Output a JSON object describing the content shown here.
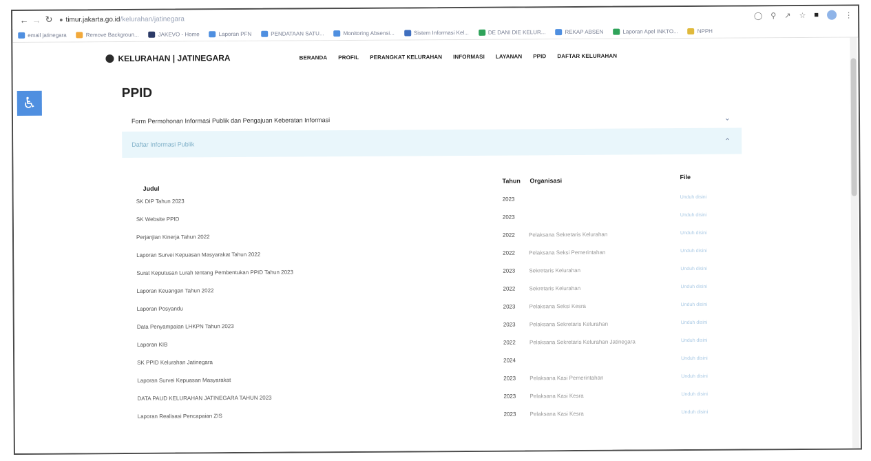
{
  "browser": {
    "url_host": "timur.jakarta.go.id",
    "bookmarks": [
      {
        "label": "email jatinegara",
        "color": "#4f8fe0"
      },
      {
        "label": "Remove Backgroun...",
        "color": "#f2a93b"
      },
      {
        "label": "JAKEVO - Home",
        "color": "#2b3a67"
      },
      {
        "label": "Laporan PFN",
        "color": "#4f8fe0"
      },
      {
        "label": "PENDATAAN SATU...",
        "color": "#4f8fe0"
      },
      {
        "label": "Monitoring Absensi...",
        "color": "#4f8fe0"
      },
      {
        "label": "Sistem Informasi Kel...",
        "color": "#3f6fbf"
      },
      {
        "label": "DE DANI DIE KELUR...",
        "color": "#2fa35a"
      },
      {
        "label": "REKAP ABSEN",
        "color": "#4f8fe0"
      },
      {
        "label": "Laporan Apel INKTO...",
        "color": "#2fa35a"
      },
      {
        "label": "NPPH",
        "color": "#e0b93b"
      }
    ]
  },
  "site": {
    "brand": "KELURAHAN | JATINEGARA",
    "menu": [
      "BERANDA",
      "PROFIL",
      "PERANGKAT KELURAHAN",
      "INFORMASI",
      "LAYANAN",
      "PPID",
      "DAFTAR KELURAHAN"
    ]
  },
  "page": {
    "title": "PPID",
    "accordion_1": "Form Permohonan Informasi Publik dan Pengajuan Keberatan Informasi",
    "accordion_2": "Daftar Informasi Publik"
  },
  "table": {
    "headers": {
      "judul": "Judul",
      "tahun": "Tahun",
      "organisasi": "Organisasi",
      "file": "File"
    },
    "rows": [
      {
        "judul": "SK DIP Tahun 2023",
        "tahun": "2023",
        "organisasi": "",
        "file": "Unduh disini"
      },
      {
        "judul": "SK Website PPID",
        "tahun": "2023",
        "organisasi": "",
        "file": "Unduh disini"
      },
      {
        "judul": "Perjanjian Kinerja Tahun 2022",
        "tahun": "2022",
        "organisasi": "Pelaksana Sekretaris Kelurahan",
        "file": "Unduh disini"
      },
      {
        "judul": "Laporan Survei Kepuasan Masyarakat Tahun 2022",
        "tahun": "2022",
        "organisasi": "Pelaksana Seksi Pemerintahan",
        "file": "Unduh disini"
      },
      {
        "judul": "Surat Keputusan Lurah tentang Pembentukan PPID Tahun 2023",
        "tahun": "2023",
        "organisasi": "Sekretaris Kelurahan",
        "file": "Unduh disini"
      },
      {
        "judul": "Laporan Keuangan Tahun 2022",
        "tahun": "2022",
        "organisasi": "Sekretaris Kelurahan",
        "file": "Unduh disini"
      },
      {
        "judul": "Laporan Posyandu",
        "tahun": "2023",
        "organisasi": "Pelaksana Seksi Kesra",
        "file": "Unduh disini"
      },
      {
        "judul": "Data Penyampaian LHKPN Tahun 2023",
        "tahun": "2023",
        "organisasi": "Pelaksana Sekretaris Kelurahan",
        "file": "Unduh disini"
      },
      {
        "judul": "Laporan KIB",
        "tahun": "2022",
        "organisasi": "Pelaksana Sekretaris Kelurahan Jatinegara",
        "file": "Unduh disini"
      },
      {
        "judul": "SK PPID Kelurahan Jatinegara",
        "tahun": "2024",
        "organisasi": "",
        "file": "Unduh disini"
      },
      {
        "judul": "Laporan Survei Kepuasan Masyarakat",
        "tahun": "2023",
        "organisasi": "Pelaksana Kasi Pemerintahan",
        "file": "Unduh disini"
      },
      {
        "judul": "DATA PAUD KELURAHAN JATINEGARA TAHUN 2023",
        "tahun": "2023",
        "organisasi": "Pelaksana Kasi Kesra",
        "file": "Unduh disini"
      },
      {
        "judul": "Laporan Realisasi Pencapaian ZIS",
        "tahun": "2023",
        "organisasi": "Pelaksana Kasi Kesra",
        "file": "Unduh disini"
      }
    ]
  }
}
